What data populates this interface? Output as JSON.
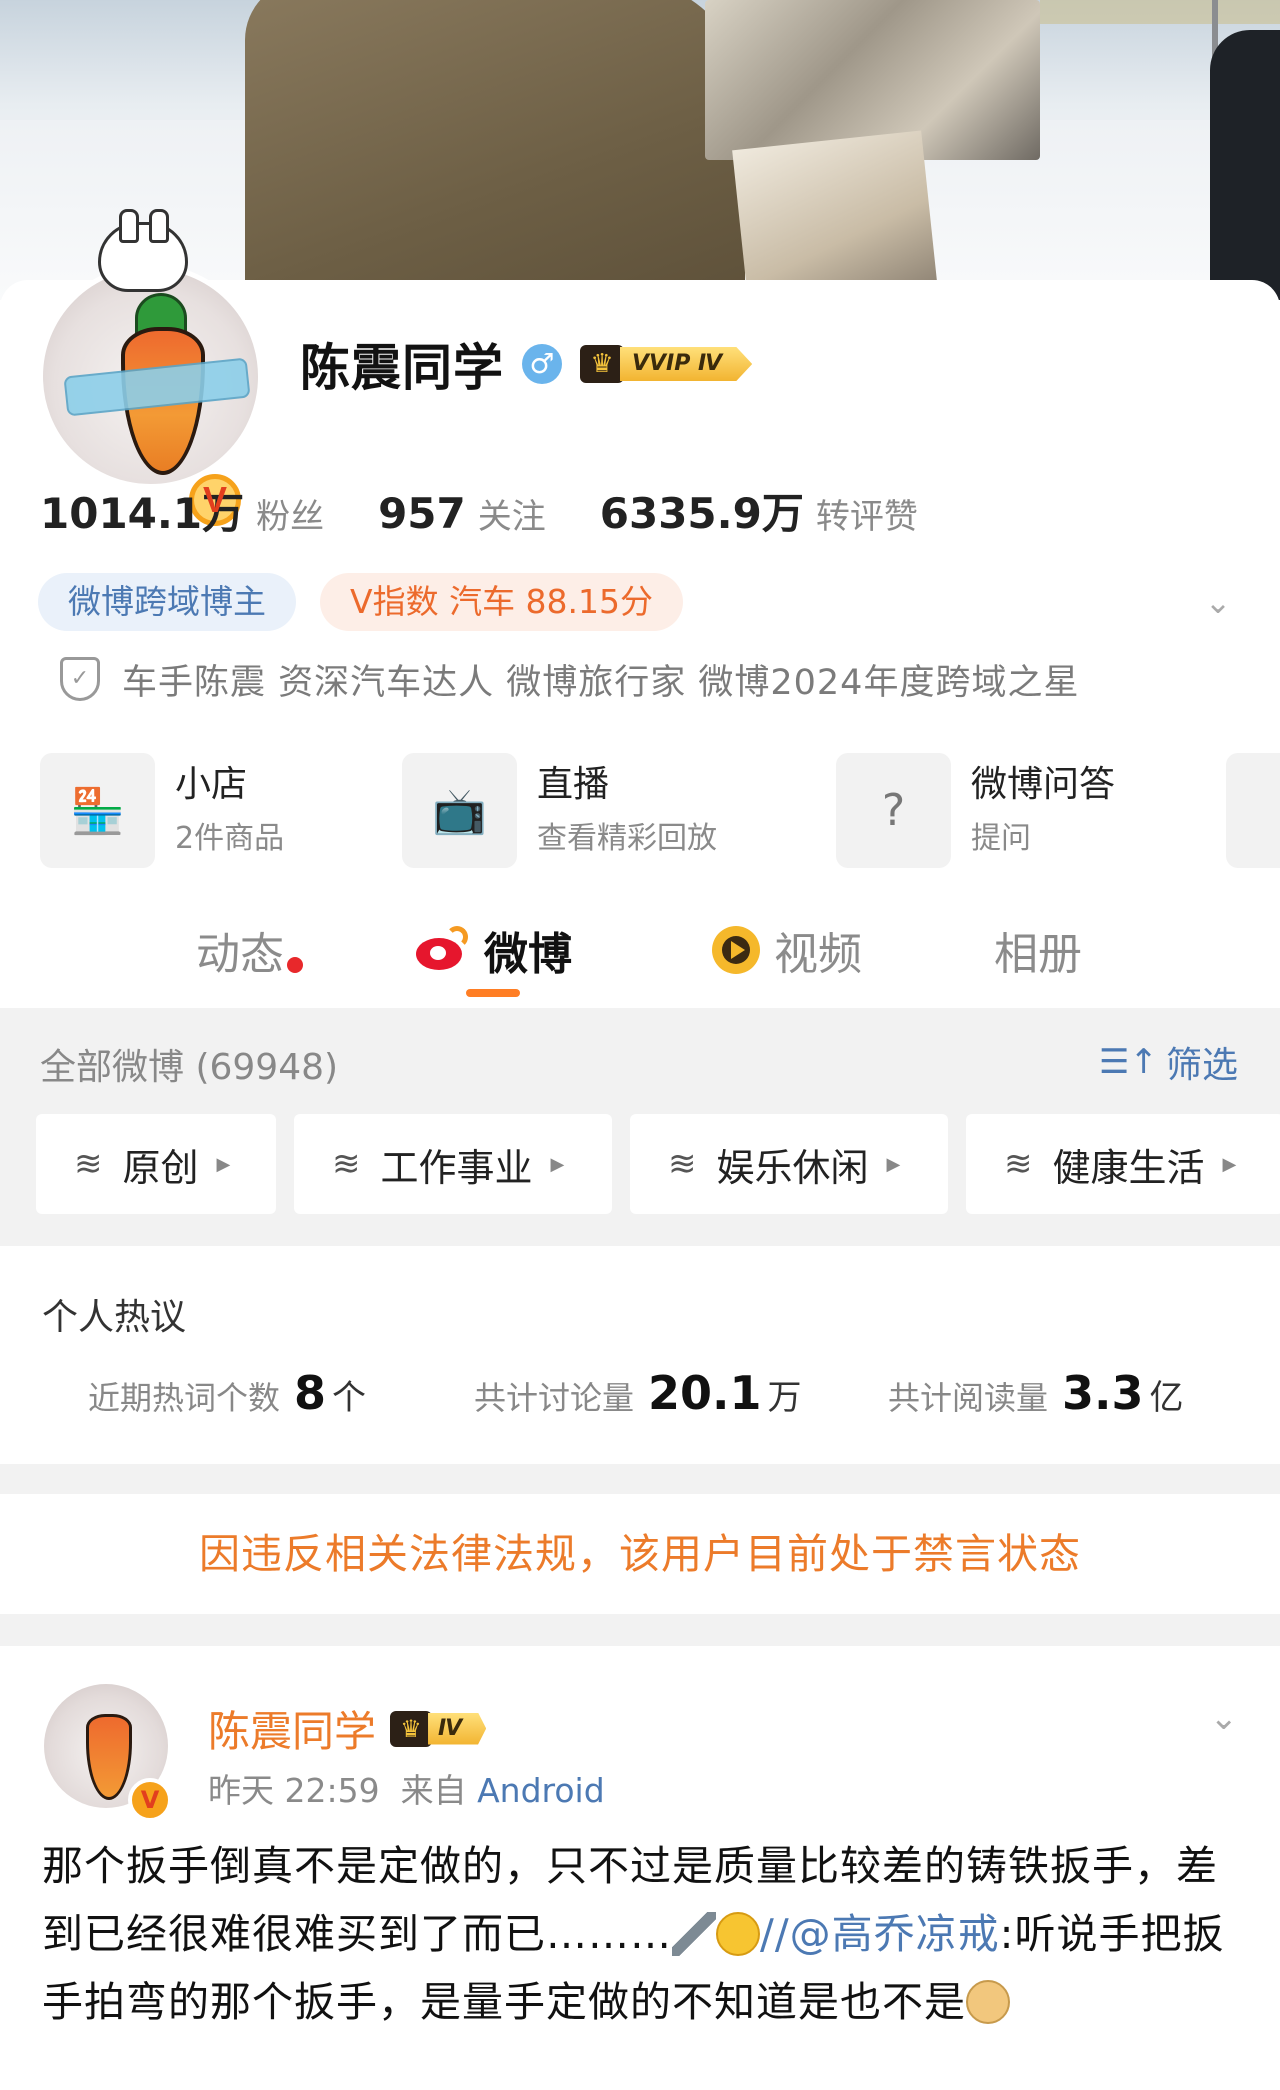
{
  "profile": {
    "name": "陈震同学",
    "gender_icon": "male-icon",
    "vip_label": "VVIP Ⅳ",
    "verified_badge": "V",
    "stats": [
      {
        "value": "1014.1万",
        "label": "粉丝"
      },
      {
        "value": "957",
        "label": "关注"
      },
      {
        "value": "6335.9万",
        "label": "转评赞"
      }
    ],
    "tags": [
      "微博跨域博主",
      "V指数 汽车 88.15分"
    ],
    "certification": "车手陈震 资深汽车达人  微博旅行家 微博2024年度跨域之星"
  },
  "services": [
    {
      "title": "小店",
      "subtitle": "2件商品",
      "icon": "shop-icon"
    },
    {
      "title": "直播",
      "subtitle": "查看精彩回放",
      "icon": "live-tv-icon"
    },
    {
      "title": "微博问答",
      "subtitle": "提问",
      "icon": "question-icon"
    }
  ],
  "tabs": [
    {
      "label": "动态",
      "has_dot": true
    },
    {
      "label": "微博",
      "active": true
    },
    {
      "label": "视频"
    },
    {
      "label": "相册"
    }
  ],
  "feed_filter": {
    "all_label": "全部微博 (69948)",
    "filter_label": "筛选",
    "chips": [
      "原创",
      "工作事业",
      "娱乐休闲",
      "健康生活"
    ]
  },
  "hot": {
    "title": "个人热议",
    "items": [
      {
        "label": "近期热词个数",
        "value": "8",
        "unit": "个"
      },
      {
        "label": "共计讨论量",
        "value": "20.1",
        "unit": "万"
      },
      {
        "label": "共计阅读量",
        "value": "3.3",
        "unit": "亿"
      }
    ]
  },
  "ban_notice": "因违反相关法律法规，该用户目前处于禁言状态",
  "post": {
    "author": "陈震同学",
    "level": "Ⅳ",
    "time": "昨天 22:59",
    "source_prefix": "来自",
    "source": "Android",
    "text_part1": "那个扳手倒真不是定做的，只不过是质量比较差的铸铁扳手，差到已经很难很难买到了而已………",
    "repost_prefix": "//",
    "mention": "@高乔凉戒",
    "text_part2": ":听说手把扳手拍弯的那个扳手，是量手定做的不知道是也不是"
  },
  "colors": {
    "accent_orange": "#ff7e24",
    "link_blue": "#4c79b3",
    "ban_orange": "#ec7b2a",
    "background_gray": "#f2f2f2"
  }
}
